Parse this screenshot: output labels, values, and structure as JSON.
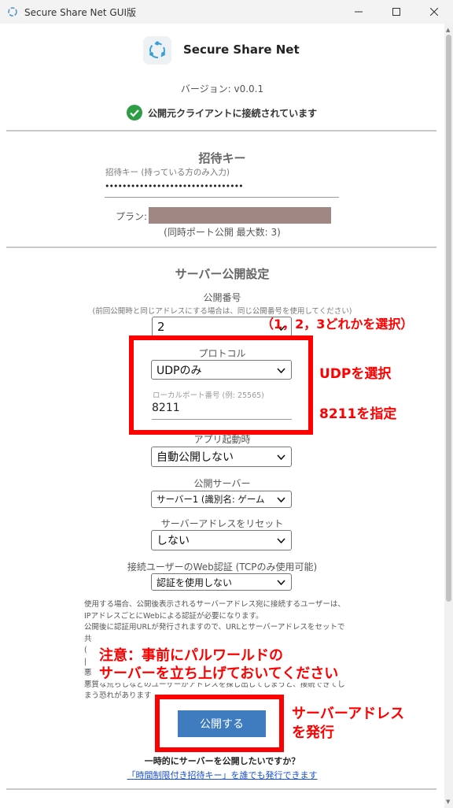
{
  "window": {
    "title": "Secure Share Net GUI版"
  },
  "header": {
    "app_name": "Secure Share Net",
    "version": "バージョン: v0.0.1",
    "status": "公開元クライアントに接続されています"
  },
  "invite": {
    "heading": "招待キー",
    "field_label": "招待キー (持っている方のみ入力)",
    "masked_value": "••••••••••••••••••••••••••••••••",
    "plan_label": "プラン:",
    "plan_limit": "(同時ポート公開 最大数: 3)"
  },
  "server": {
    "heading": "サーバー公開設定",
    "number_label": "公開番号",
    "number_hint": "(前回公開時と同じアドレスにする場合は、同じ公開番号を使用してください)",
    "number_value": "2",
    "protocol_label": "プロトコル",
    "protocol_value": "UDPのみ",
    "port_label": "ローカルポート番号 (例: 25565)",
    "port_value": "8211",
    "startup_label": "アプリ起動時",
    "startup_value": "自動公開しない",
    "pub_server_label": "公開サーバー",
    "pub_server_value": "サーバー1 (識別名: ゲーム",
    "reset_label": "サーバーアドレスをリセット",
    "reset_value": "しない",
    "auth_label": "接続ユーザーのWeb認証 (TCPのみ使用可能)",
    "auth_value": "認証を使用しない"
  },
  "description": [
    "使用する場合、公開後表示されるサーバーアドレス宛に接続するユーザーは、",
    "IPアドレスごとにWebによる認証が必要になります。",
    "公開後に認証用URLが発行されますので、URLとサーバーアドレスをセットで",
    "共",
    "(",
    "|",
    "悪",
    "悪質な荒らしなどのユーザーがアドレスを探し出してしまうと、接続できてし",
    "まう恐れがあります"
  ],
  "publish_button": "公開する",
  "temp_question": "一時的にサーバーを公開したいですか？",
  "temp_link": "「時間制限付き招待キー」を誰でも発行できます",
  "annotations": {
    "select_number": "（1，2，3どれかを選択）",
    "select_udp": "UDPを選択",
    "specify_port": "8211を指定",
    "notice_line1": "注意：事前にパルワールドの",
    "notice_line2": "サーバーを立ち上げておいてください",
    "issue_line1": "サーバーアドレス",
    "issue_line2": "を発行"
  },
  "colors": {
    "accent": "#3e7bbf",
    "status_ok": "#2e9e44",
    "annotation": "#ff0000",
    "redacted": "#a08784"
  }
}
